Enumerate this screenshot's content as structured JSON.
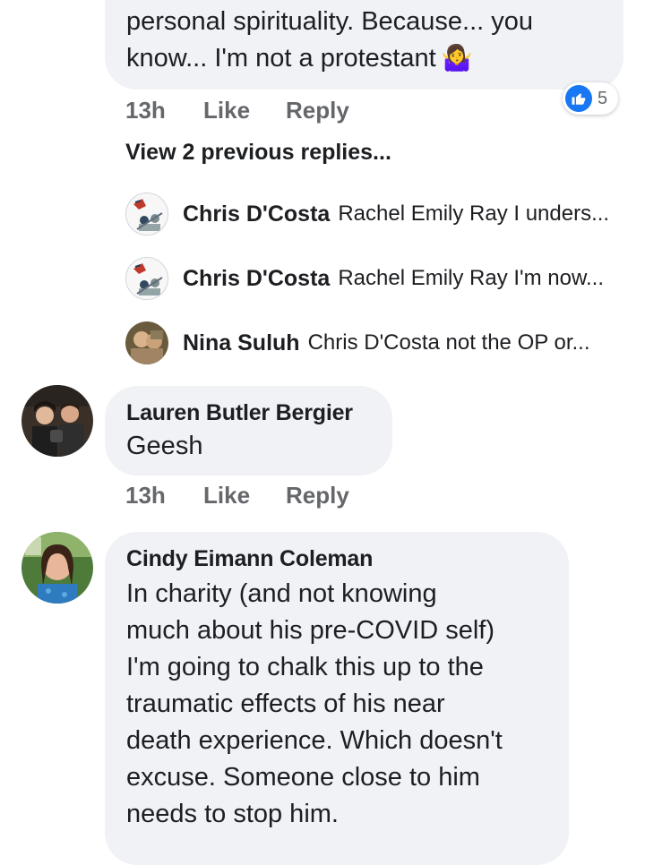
{
  "top_comment": {
    "text": "personal spirituality.  Because... you\nknow... I'm not a protestant",
    "emoji": "🤷‍♀️",
    "time": "13h",
    "like": "Like",
    "reply": "Reply",
    "reaction_count": "5",
    "reaction_icon": "thumbs-up-icon"
  },
  "view_previous": "View 2 previous replies...",
  "replies": [
    {
      "name": "Chris D'Costa",
      "snippet": "Rachel Emily Ray I unders..."
    },
    {
      "name": "Chris D'Costa",
      "snippet": "Rachel Emily Ray I'm now..."
    },
    {
      "name": "Nina Suluh",
      "snippet": "Chris D'Costa not the OP or..."
    }
  ],
  "comment_lauren": {
    "name": "Lauren Butler Bergier",
    "text": "Geesh",
    "time": "13h",
    "like": "Like",
    "reply": "Reply"
  },
  "comment_cindy": {
    "name": "Cindy Eimann Coleman",
    "text": "In charity (and not knowing\nmuch about his pre-COVID self)\nI'm going to chalk this up to the\ntraumatic effects of his near\ndeath experience.  Which doesn't\nexcuse.  Someone close to him\nneeds to stop him."
  },
  "colors": {
    "bubble": "#f0f2f5",
    "meta_text": "#65676b",
    "like_blue": "#1877f2"
  }
}
